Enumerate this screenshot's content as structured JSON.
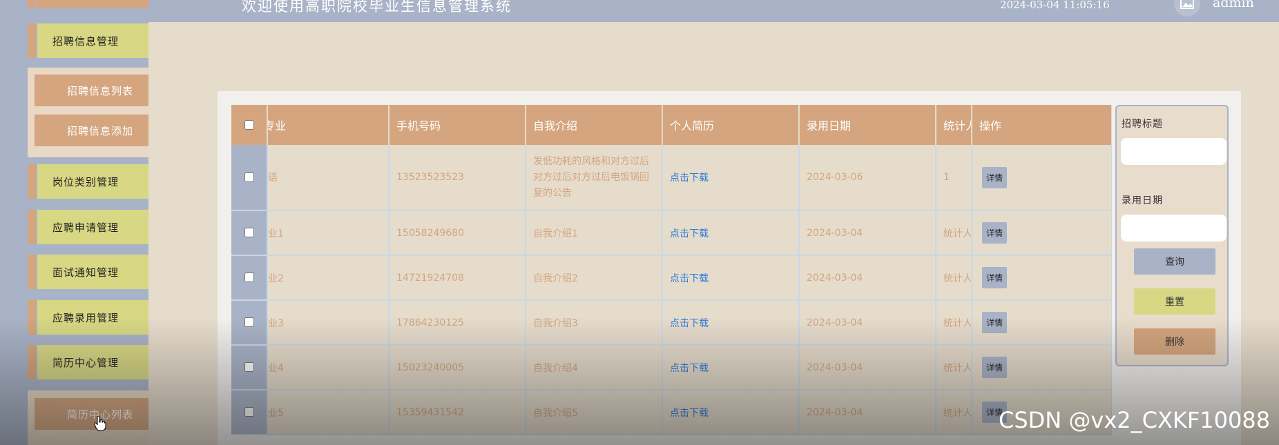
{
  "header": {
    "title": "欢迎使用高职院校毕业生信息管理系统",
    "datetime": "2024-03-04 11:05:16",
    "username": "admin",
    "avatar_icon": "image-icon"
  },
  "sidebar": {
    "items": [
      {
        "label": "招聘信息管理"
      },
      {
        "label": "招聘信息列表"
      },
      {
        "label": "招聘信息添加"
      },
      {
        "label": "岗位类别管理"
      },
      {
        "label": "应聘申请管理"
      },
      {
        "label": "面试通知管理"
      },
      {
        "label": "应聘录用管理"
      },
      {
        "label": "简历中心管理"
      },
      {
        "label": "简历中心列表"
      }
    ]
  },
  "table": {
    "columns": [
      "专业",
      "手机号码",
      "自我介绍",
      "个人简历",
      "录用日期",
      "统计人",
      "操作"
    ],
    "rows": [
      {
        "major": "语",
        "phone": "13523523523",
        "intro": "发低功耗的风格和对方过后对方过后对方过后电饭锅回复的公告",
        "resume": "点击下载",
        "date": "2024-03-06",
        "stat": "1",
        "action": "详情"
      },
      {
        "major": "业1",
        "phone": "15058249680",
        "intro": "自我介绍1",
        "resume": "点击下载",
        "date": "2024-03-04",
        "stat": "统计人",
        "action": "详情"
      },
      {
        "major": "业2",
        "phone": "14721924708",
        "intro": "自我介绍2",
        "resume": "点击下载",
        "date": "2024-03-04",
        "stat": "统计人",
        "action": "详情"
      },
      {
        "major": "业3",
        "phone": "17864230125",
        "intro": "自我介绍3",
        "resume": "点击下载",
        "date": "2024-03-04",
        "stat": "统计人",
        "action": "详情"
      },
      {
        "major": "业4",
        "phone": "15023240005",
        "intro": "自我介绍4",
        "resume": "点击下载",
        "date": "2024-03-04",
        "stat": "统计人",
        "action": "详情"
      },
      {
        "major": "业5",
        "phone": "15359431542",
        "intro": "自我介绍5",
        "resume": "点击下载",
        "date": "2024-03-04",
        "stat": "统计人",
        "action": "详情"
      }
    ]
  },
  "search": {
    "label_title": "招聘标题",
    "label_date": "录用日期",
    "query": "查询",
    "reset": "重置",
    "delete": "删除"
  },
  "colors": {
    "tan": "#d4a57e",
    "olive": "#d7d784",
    "slate": "#a9b3c7",
    "bg": "#e6dccc",
    "link": "#2a7bd8"
  },
  "watermark": "CSDN @vx2_CXKF10088"
}
